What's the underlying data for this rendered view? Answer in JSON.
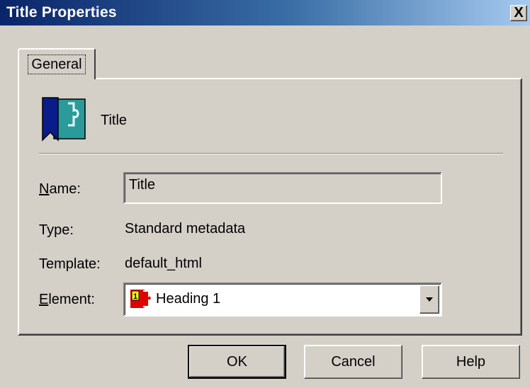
{
  "window": {
    "title": "Title Properties",
    "close_label": "X"
  },
  "tabs": [
    {
      "label": "General",
      "active": true
    }
  ],
  "header": {
    "icon": "title-bookmark-puzzle-icon",
    "title": "Title"
  },
  "fields": {
    "name": {
      "label_prefix": "",
      "label_key": "N",
      "label_rest": "ame:",
      "value": "Title"
    },
    "type": {
      "label": "Type:",
      "value": "Standard metadata"
    },
    "template": {
      "label": "Template:",
      "value": "default_html"
    },
    "element": {
      "label_key": "E",
      "label_rest": "lement:",
      "value": "Heading 1",
      "icon": "heading-tag-icon"
    }
  },
  "buttons": {
    "ok": "OK",
    "cancel": "Cancel",
    "help": "Help"
  },
  "colors": {
    "titlebar_start": "#0a246a",
    "titlebar_end": "#a6caf0",
    "face": "#d4d0c8"
  }
}
